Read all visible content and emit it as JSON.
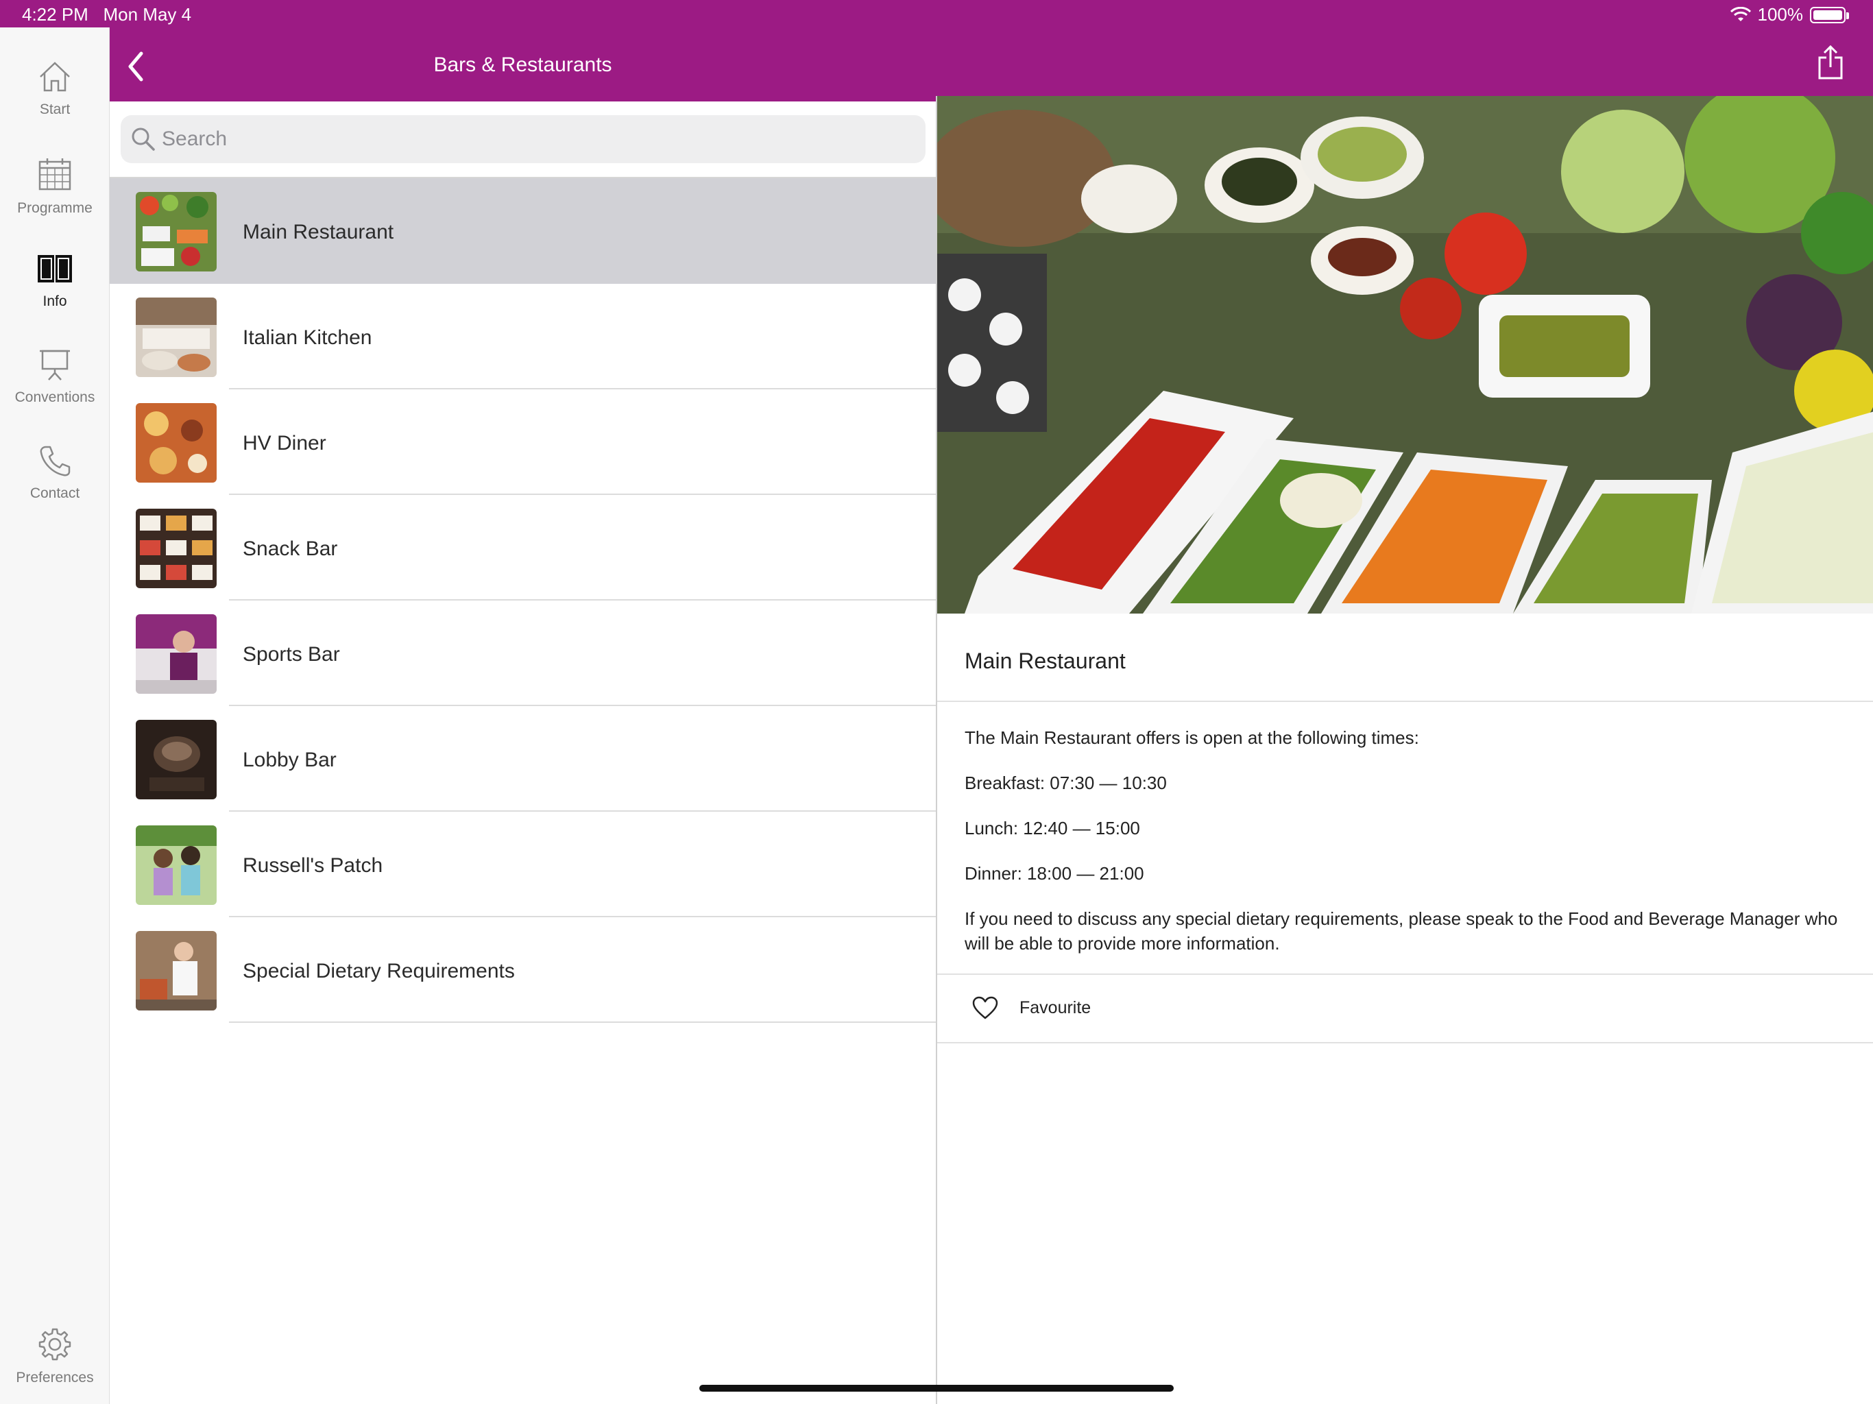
{
  "status_bar": {
    "time": "4:22 PM",
    "date": "Mon May 4",
    "battery": "100%",
    "icons": [
      "wifi-icon",
      "battery-icon"
    ]
  },
  "header": {
    "title": "Bars & Restaurants",
    "back_icon": "chevron-left-icon",
    "share_icon": "share-icon",
    "color": "#9c1b84"
  },
  "sidebar": {
    "items": [
      {
        "label": "Start",
        "icon": "home-icon"
      },
      {
        "label": "Programme",
        "icon": "calendar-icon"
      },
      {
        "label": "Info",
        "icon": "book-icon",
        "active": true
      },
      {
        "label": "Conventions",
        "icon": "presentation-icon"
      },
      {
        "label": "Contact",
        "icon": "phone-icon"
      }
    ],
    "preferences": {
      "label": "Preferences",
      "icon": "gear-icon"
    }
  },
  "search": {
    "placeholder": "Search",
    "value": ""
  },
  "list": {
    "items": [
      {
        "label": "Main Restaurant",
        "selected": true
      },
      {
        "label": "Italian Kitchen"
      },
      {
        "label": "HV Diner"
      },
      {
        "label": "Snack Bar"
      },
      {
        "label": "Sports Bar"
      },
      {
        "label": "Lobby Bar"
      },
      {
        "label": "Russell's Patch"
      },
      {
        "label": "Special Dietary Requirements"
      }
    ]
  },
  "detail": {
    "title": "Main Restaurant",
    "paragraphs": [
      "The Main Restaurant offers is open at the following times:",
      "Breakfast: 07:30 — 10:30",
      "Lunch: 12:40 — 15:00",
      "Dinner: 18:00 — 21:00",
      "If you need to discuss any special dietary requirements, please speak to the Food and Beverage Manager who will be able to provide more information."
    ],
    "favourite_label": "Favourite"
  },
  "colors": {
    "accent": "#9c1b84",
    "selected_row": "#d1d1d6"
  }
}
